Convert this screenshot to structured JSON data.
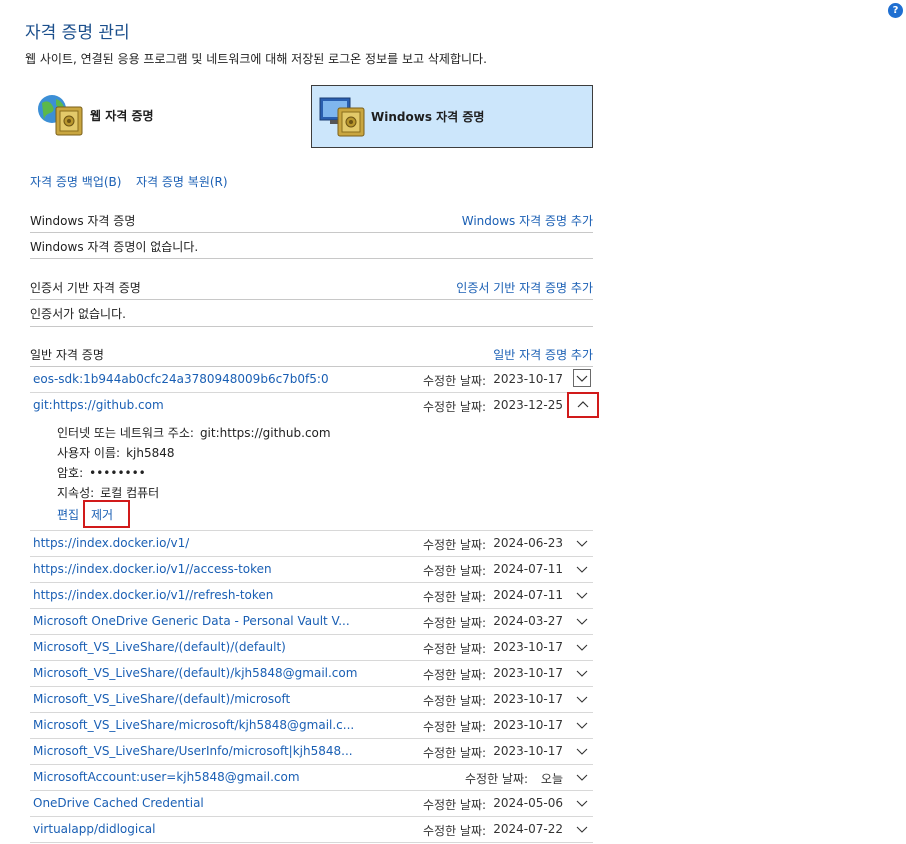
{
  "help": {
    "icon": "help-icon",
    "label": "?"
  },
  "title": "자격 증명 관리",
  "description": "웹 사이트, 연결된 응용 프로그램 및 네트워크에 대해 저장된 로그온 정보를 보고 삭제합니다.",
  "tiles": {
    "web": {
      "label": "웹 자격 증명",
      "icon": "globe-vault-icon"
    },
    "windows": {
      "label": "Windows 자격 증명",
      "icon": "monitor-vault-icon",
      "selected": true
    }
  },
  "actions": {
    "backup": "자격 증명 백업(B)",
    "restore": "자격 증명 복원(R)"
  },
  "sections": {
    "windows": {
      "title": "Windows 자격 증명",
      "add": "Windows 자격 증명 추가",
      "empty": "Windows 자격 증명이 없습니다."
    },
    "cert": {
      "title": "인증서 기반 자격 증명",
      "add": "인증서 기반 자격 증명 추가",
      "empty": "인증서가 없습니다."
    },
    "generic": {
      "title": "일반 자격 증명",
      "add": "일반 자격 증명 추가"
    }
  },
  "modified_label": "수정한 날짜:",
  "expanded": {
    "name": "git:https://github.com",
    "date": "2023-12-25",
    "address_label": "인터넷 또는 네트워크 주소:",
    "address": "git:https://github.com",
    "user_label": "사용자 이름:",
    "user": "kjh5848",
    "password_label": "암호:",
    "password": "••••••••",
    "persistence_label": "지속성:",
    "persistence": "로컬 컴퓨터",
    "edit": "편집",
    "remove": "제거"
  },
  "credentials": [
    {
      "name": "eos-sdk:1b944ab0cfc24a3780948009b6c7b0f5:0",
      "date": "2023-10-17"
    },
    {
      "name": "https://index.docker.io/v1/",
      "date": "2024-06-23"
    },
    {
      "name": "https://index.docker.io/v1//access-token",
      "date": "2024-07-11"
    },
    {
      "name": "https://index.docker.io/v1//refresh-token",
      "date": "2024-07-11"
    },
    {
      "name": "Microsoft OneDrive Generic Data - Personal Vault V...",
      "date": "2024-03-27"
    },
    {
      "name": "Microsoft_VS_LiveShare/(default)/(default)",
      "date": "2023-10-17"
    },
    {
      "name": "Microsoft_VS_LiveShare/(default)/kjh5848@gmail.com",
      "date": "2023-10-17"
    },
    {
      "name": "Microsoft_VS_LiveShare/(default)/microsoft",
      "date": "2023-10-17"
    },
    {
      "name": "Microsoft_VS_LiveShare/microsoft/kjh5848@gmail.c...",
      "date": "2023-10-17"
    },
    {
      "name": "Microsoft_VS_LiveShare/UserInfo/microsoft|kjh5848...",
      "date": "2023-10-17"
    },
    {
      "name": "MicrosoftAccount:user=kjh5848@gmail.com",
      "date": "오늘"
    },
    {
      "name": "OneDrive Cached Credential",
      "date": "2024-05-06"
    },
    {
      "name": "virtualapp/didlogical",
      "date": "2024-07-22"
    }
  ]
}
